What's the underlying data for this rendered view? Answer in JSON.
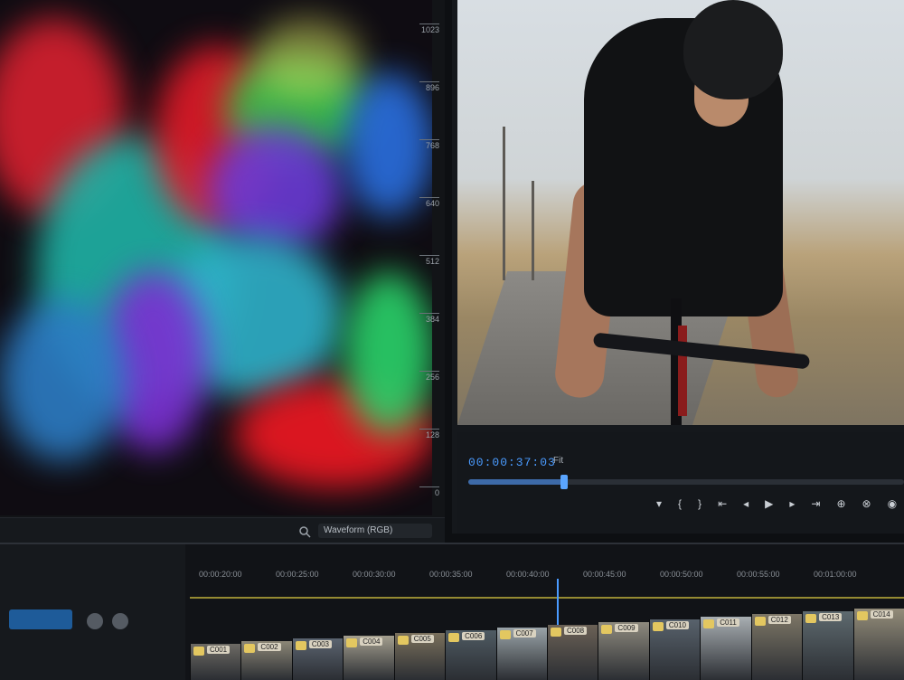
{
  "scope": {
    "scale_ticks": [
      "1023",
      "896",
      "768",
      "640",
      "512",
      "384",
      "256",
      "128",
      "0"
    ],
    "mode_select": "Waveform (RGB)",
    "zoom_icon": "zoom-icon"
  },
  "monitor": {
    "timecode": "00:00:37:03",
    "fit": "Fit",
    "playhead_progress": 0.22,
    "transport_icons": [
      "marker-icon",
      "in-point-icon",
      "out-point-icon",
      "go-to-in-icon",
      "step-back-icon",
      "play-icon",
      "step-forward-icon",
      "go-to-out-icon",
      "insert-icon",
      "overwrite-icon",
      "export-frame-icon"
    ]
  },
  "timeline": {
    "ruler_labels": [
      "00:00:20:00",
      "00:00:25:00",
      "00:00:30:00",
      "00:00:35:00",
      "00:00:40:00",
      "00:00:45:00",
      "00:00:50:00",
      "00:00:55:00",
      "00:01:00:00"
    ],
    "clips": [
      "C001",
      "C002",
      "C003",
      "C004",
      "C005",
      "C006",
      "C007",
      "C008",
      "C009",
      "C010",
      "C011",
      "C012",
      "C013",
      "C014"
    ],
    "accent_color": "#4a9bff"
  },
  "colors": {
    "timecode": "#4a9bff",
    "panel_bg": "#15181c",
    "clip_label": "#e3c760"
  }
}
